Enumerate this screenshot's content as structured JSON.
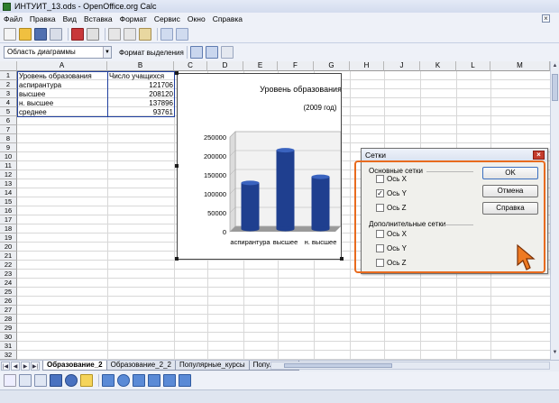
{
  "window": {
    "title": "ИНТУИТ_13.ods - OpenOffice.org Calc"
  },
  "menu": [
    "Файл",
    "Правка",
    "Вид",
    "Вставка",
    "Формат",
    "Сервис",
    "Окно",
    "Справка"
  ],
  "formatbar": {
    "area_combo": "Область диаграммы",
    "format_selection": "Формат выделения"
  },
  "sheet": {
    "columns": [
      "A",
      "B",
      "C",
      "D",
      "E",
      "F",
      "G",
      "H",
      "J",
      "K",
      "L",
      "M"
    ],
    "rows": [
      "1",
      "2",
      "3",
      "4",
      "5",
      "6",
      "7",
      "8",
      "9",
      "10",
      "11",
      "12",
      "13",
      "14",
      "15",
      "16",
      "17",
      "18",
      "19",
      "20",
      "21",
      "22",
      "23",
      "24",
      "25",
      "26",
      "27",
      "28",
      "29",
      "30",
      "31",
      "32"
    ],
    "data": [
      {
        "a": "Уровень образования",
        "b": "Число учащихся"
      },
      {
        "a": "аспирантура",
        "b": "121706"
      },
      {
        "a": "высшее",
        "b": "208120"
      },
      {
        "a": "н. высшее",
        "b": "137896"
      },
      {
        "a": "среднее",
        "b": "93761"
      }
    ]
  },
  "chart_data": {
    "type": "bar",
    "title": "Уровень образования учащихся",
    "subtitle": "(2009 год)",
    "categories": [
      "аспирантура",
      "высшее",
      "н. высшее"
    ],
    "values": [
      121706,
      208120,
      137896
    ],
    "yticks": [
      "250000",
      "200000",
      "150000",
      "100000",
      "50000",
      "0"
    ],
    "ylim": [
      0,
      250000
    ],
    "bar_color": "#1f3f8f"
  },
  "dialog": {
    "title": "Сетки",
    "major_group": "Основные сетки",
    "major": [
      {
        "label": "Ось X",
        "checked": false
      },
      {
        "label": "Ось Y",
        "checked": true
      },
      {
        "label": "Ось Z",
        "checked": false
      }
    ],
    "minor_group": "Дополнительные сетки",
    "minor": [
      {
        "label": "Ось X",
        "checked": false
      },
      {
        "label": "Ось Y",
        "checked": false
      },
      {
        "label": "Ось Z",
        "checked": false
      }
    ],
    "ok": "OK",
    "cancel": "Отмена",
    "help": "Справка"
  },
  "tabs": [
    "Образование_2",
    "Образование_2_2",
    "Популярные_курсы",
    "Популярные"
  ],
  "colors": {
    "highlight": "#e86b1e",
    "selection": "#2040a0"
  }
}
